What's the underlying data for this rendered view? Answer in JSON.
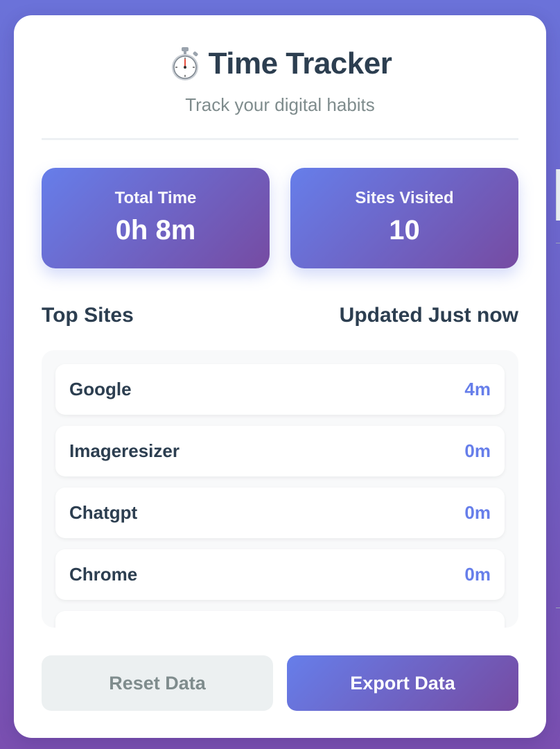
{
  "header": {
    "icon": "stopwatch-icon",
    "title": "Time Tracker",
    "subtitle": "Track your digital habits"
  },
  "stats": {
    "total_time_label": "Total Time",
    "total_time_value": "0h 8m",
    "sites_visited_label": "Sites Visited",
    "sites_visited_value": "10"
  },
  "top_sites": {
    "title": "Top Sites",
    "updated": "Updated Just now",
    "items": [
      {
        "name": "Google",
        "time": "4m"
      },
      {
        "name": "Imageresizer",
        "time": "0m"
      },
      {
        "name": "Chatgpt",
        "time": "0m"
      },
      {
        "name": "Chrome",
        "time": "0m"
      },
      {
        "name": "",
        "time": ""
      }
    ]
  },
  "buttons": {
    "reset_label": "Reset Data",
    "export_label": "Export Data"
  },
  "colors": {
    "accent_start": "#667eea",
    "accent_end": "#764ba2",
    "text_dark": "#2c3e50",
    "text_muted": "#7f8c8d"
  }
}
